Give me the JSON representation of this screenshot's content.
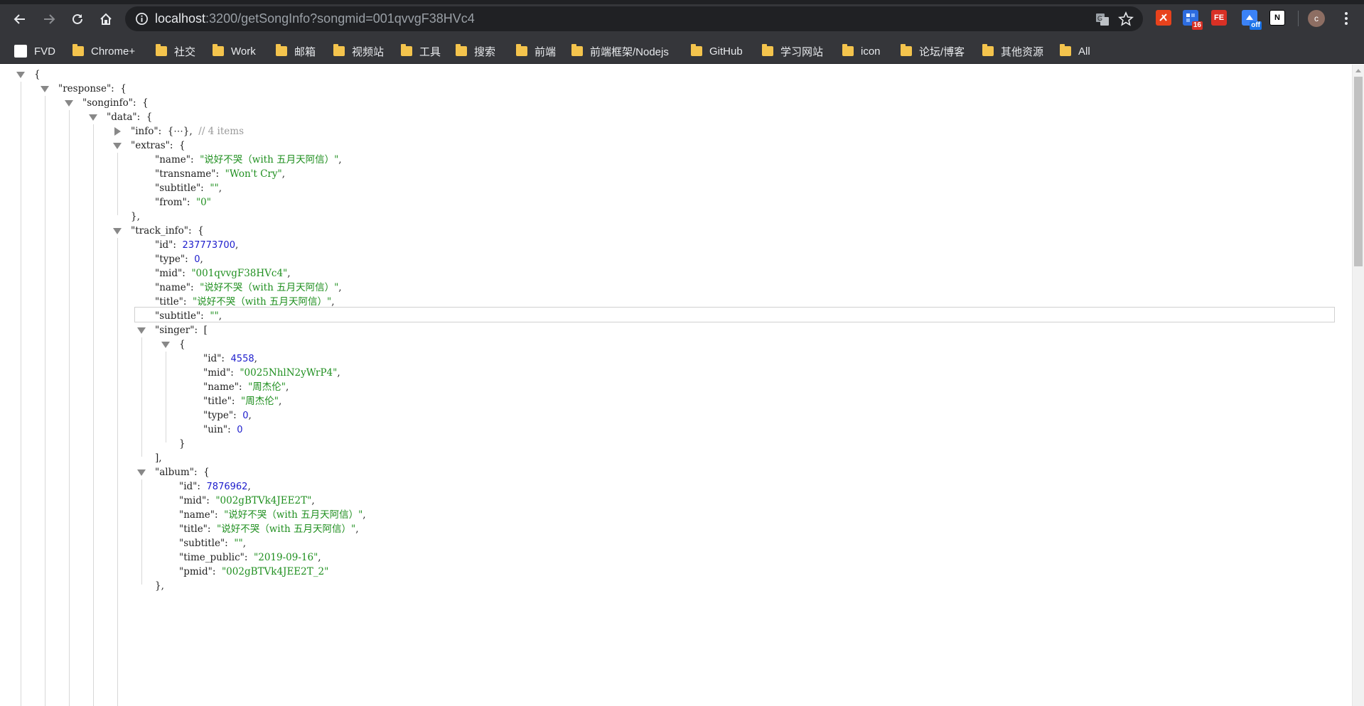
{
  "browser": {
    "url_host": "localhost",
    "url_rest": ":3200/getSongInfo?songmid=001qvvgF38HVc4",
    "avatar_letter": "c",
    "extensions": [
      {
        "name": "extension-1",
        "label": "",
        "color": "#e8421c"
      },
      {
        "name": "extension-2",
        "label": "",
        "badge": "16",
        "color": "#2d6cdf"
      },
      {
        "name": "extension-fe",
        "label": "FE",
        "color": "#d93025"
      },
      {
        "name": "extension-off",
        "label": "",
        "badge": "off",
        "color": "#3b82f6"
      },
      {
        "name": "extension-notion",
        "label": "N",
        "color": "#ffffff"
      }
    ]
  },
  "bookmarks": [
    "FVD",
    "Chrome+",
    "社交",
    "Work",
    "邮箱",
    "视频站",
    "工具",
    "搜索",
    "前端",
    "前端框架/Nodejs",
    "GitHub",
    "学习网站",
    "icon",
    "论坛/博客",
    "其他资源",
    "All"
  ],
  "json_lines": [
    {
      "indent": 0,
      "toggle": "down",
      "parts": [
        [
          "p",
          "{"
        ]
      ]
    },
    {
      "indent": 1,
      "toggle": "down",
      "parts": [
        [
          "key",
          "\"response\""
        ],
        [
          "p",
          ":  {"
        ]
      ]
    },
    {
      "indent": 2,
      "toggle": "down",
      "parts": [
        [
          "key",
          "\"songinfo\""
        ],
        [
          "p",
          ":  {"
        ]
      ]
    },
    {
      "indent": 3,
      "toggle": "down",
      "parts": [
        [
          "key",
          "\"data\""
        ],
        [
          "p",
          ":  {"
        ]
      ]
    },
    {
      "indent": 4,
      "toggle": "right",
      "parts": [
        [
          "key",
          "\"info\""
        ],
        [
          "p",
          ":  {"
        ],
        [
          "p",
          "⋯"
        ],
        [
          "p",
          "},"
        ],
        [
          "c",
          "  // 4 items"
        ]
      ]
    },
    {
      "indent": 4,
      "toggle": "down",
      "parts": [
        [
          "key",
          "\"extras\""
        ],
        [
          "p",
          ":  {"
        ]
      ]
    },
    {
      "indent": 5,
      "toggle": "",
      "parts": [
        [
          "key",
          "\"name\""
        ],
        [
          "p",
          ":  "
        ],
        [
          "s",
          "\"说好不哭（with 五月天阿信）\""
        ],
        [
          "p",
          ","
        ]
      ]
    },
    {
      "indent": 5,
      "toggle": "",
      "parts": [
        [
          "key",
          "\"transname\""
        ],
        [
          "p",
          ":  "
        ],
        [
          "s",
          "\"Won't Cry\""
        ],
        [
          "p",
          ","
        ]
      ]
    },
    {
      "indent": 5,
      "toggle": "",
      "parts": [
        [
          "key",
          "\"subtitle\""
        ],
        [
          "p",
          ":  "
        ],
        [
          "s",
          "\"\""
        ],
        [
          "p",
          ","
        ]
      ]
    },
    {
      "indent": 5,
      "toggle": "",
      "parts": [
        [
          "key",
          "\"from\""
        ],
        [
          "p",
          ":  "
        ],
        [
          "s",
          "\"0\""
        ]
      ]
    },
    {
      "indent": 4,
      "toggle": "",
      "parts": [
        [
          "p",
          "},"
        ]
      ]
    },
    {
      "indent": 4,
      "toggle": "down",
      "parts": [
        [
          "key",
          "\"track_info\""
        ],
        [
          "p",
          ":  {"
        ]
      ]
    },
    {
      "indent": 5,
      "toggle": "",
      "parts": [
        [
          "key",
          "\"id\""
        ],
        [
          "p",
          ":  "
        ],
        [
          "n",
          "237773700"
        ],
        [
          "p",
          ","
        ]
      ]
    },
    {
      "indent": 5,
      "toggle": "",
      "parts": [
        [
          "key",
          "\"type\""
        ],
        [
          "p",
          ":  "
        ],
        [
          "n",
          "0"
        ],
        [
          "p",
          ","
        ]
      ]
    },
    {
      "indent": 5,
      "toggle": "",
      "parts": [
        [
          "key",
          "\"mid\""
        ],
        [
          "p",
          ":  "
        ],
        [
          "s",
          "\"001qvvgF38HVc4\""
        ],
        [
          "p",
          ","
        ]
      ]
    },
    {
      "indent": 5,
      "toggle": "",
      "parts": [
        [
          "key",
          "\"name\""
        ],
        [
          "p",
          ":  "
        ],
        [
          "s",
          "\"说好不哭（with 五月天阿信）\""
        ],
        [
          "p",
          ","
        ]
      ]
    },
    {
      "indent": 5,
      "toggle": "",
      "parts": [
        [
          "key",
          "\"title\""
        ],
        [
          "p",
          ":  "
        ],
        [
          "s",
          "\"说好不哭（with 五月天阿信）\""
        ],
        [
          "p",
          ","
        ]
      ]
    },
    {
      "indent": 5,
      "toggle": "",
      "parts": [
        [
          "key",
          "\"subtitle\""
        ],
        [
          "p",
          ":  "
        ],
        [
          "s",
          "\"\""
        ],
        [
          "p",
          ","
        ]
      ]
    },
    {
      "indent": 5,
      "toggle": "down",
      "parts": [
        [
          "key",
          "\"singer\""
        ],
        [
          "p",
          ":  ["
        ]
      ]
    },
    {
      "indent": 6,
      "toggle": "down",
      "parts": [
        [
          "p",
          "{"
        ]
      ]
    },
    {
      "indent": 7,
      "toggle": "",
      "parts": [
        [
          "key",
          "\"id\""
        ],
        [
          "p",
          ":  "
        ],
        [
          "n",
          "4558"
        ],
        [
          "p",
          ","
        ]
      ]
    },
    {
      "indent": 7,
      "toggle": "",
      "parts": [
        [
          "key",
          "\"mid\""
        ],
        [
          "p",
          ":  "
        ],
        [
          "s",
          "\"0025NhlN2yWrP4\""
        ],
        [
          "p",
          ","
        ]
      ]
    },
    {
      "indent": 7,
      "toggle": "",
      "parts": [
        [
          "key",
          "\"name\""
        ],
        [
          "p",
          ":  "
        ],
        [
          "s",
          "\"周杰伦\""
        ],
        [
          "p",
          ","
        ]
      ]
    },
    {
      "indent": 7,
      "toggle": "",
      "parts": [
        [
          "key",
          "\"title\""
        ],
        [
          "p",
          ":  "
        ],
        [
          "s",
          "\"周杰伦\""
        ],
        [
          "p",
          ","
        ]
      ]
    },
    {
      "indent": 7,
      "toggle": "",
      "parts": [
        [
          "key",
          "\"type\""
        ],
        [
          "p",
          ":  "
        ],
        [
          "n",
          "0"
        ],
        [
          "p",
          ","
        ]
      ]
    },
    {
      "indent": 7,
      "toggle": "",
      "parts": [
        [
          "key",
          "\"uin\""
        ],
        [
          "p",
          ":  "
        ],
        [
          "n",
          "0"
        ]
      ]
    },
    {
      "indent": 6,
      "toggle": "",
      "parts": [
        [
          "p",
          "}"
        ]
      ]
    },
    {
      "indent": 5,
      "toggle": "",
      "parts": [
        [
          "p",
          "],"
        ]
      ]
    },
    {
      "indent": 5,
      "toggle": "down",
      "parts": [
        [
          "key",
          "\"album\""
        ],
        [
          "p",
          ":  {"
        ]
      ]
    },
    {
      "indent": 6,
      "toggle": "",
      "parts": [
        [
          "key",
          "\"id\""
        ],
        [
          "p",
          ":  "
        ],
        [
          "n",
          "7876962"
        ],
        [
          "p",
          ","
        ]
      ]
    },
    {
      "indent": 6,
      "toggle": "",
      "parts": [
        [
          "key",
          "\"mid\""
        ],
        [
          "p",
          ":  "
        ],
        [
          "s",
          "\"002gBTVk4JEE2T\""
        ],
        [
          "p",
          ","
        ]
      ]
    },
    {
      "indent": 6,
      "toggle": "",
      "parts": [
        [
          "key",
          "\"name\""
        ],
        [
          "p",
          ":  "
        ],
        [
          "s",
          "\"说好不哭（with 五月天阿信）\""
        ],
        [
          "p",
          ","
        ]
      ]
    },
    {
      "indent": 6,
      "toggle": "",
      "parts": [
        [
          "key",
          "\"title\""
        ],
        [
          "p",
          ":  "
        ],
        [
          "s",
          "\"说好不哭（with 五月天阿信）\""
        ],
        [
          "p",
          ","
        ]
      ]
    },
    {
      "indent": 6,
      "toggle": "",
      "parts": [
        [
          "key",
          "\"subtitle\""
        ],
        [
          "p",
          ":  "
        ],
        [
          "s",
          "\"\""
        ],
        [
          "p",
          ","
        ]
      ]
    },
    {
      "indent": 6,
      "toggle": "",
      "parts": [
        [
          "key",
          "\"time_public\""
        ],
        [
          "p",
          ":  "
        ],
        [
          "s",
          "\"2019-09-16\""
        ],
        [
          "p",
          ","
        ]
      ]
    },
    {
      "indent": 6,
      "toggle": "",
      "parts": [
        [
          "key",
          "\"pmid\""
        ],
        [
          "p",
          ":  "
        ],
        [
          "s",
          "\"002gBTVk4JEE2T_2\""
        ]
      ]
    },
    {
      "indent": 5,
      "toggle": "",
      "parts": [
        [
          "p",
          "},"
        ]
      ]
    }
  ]
}
